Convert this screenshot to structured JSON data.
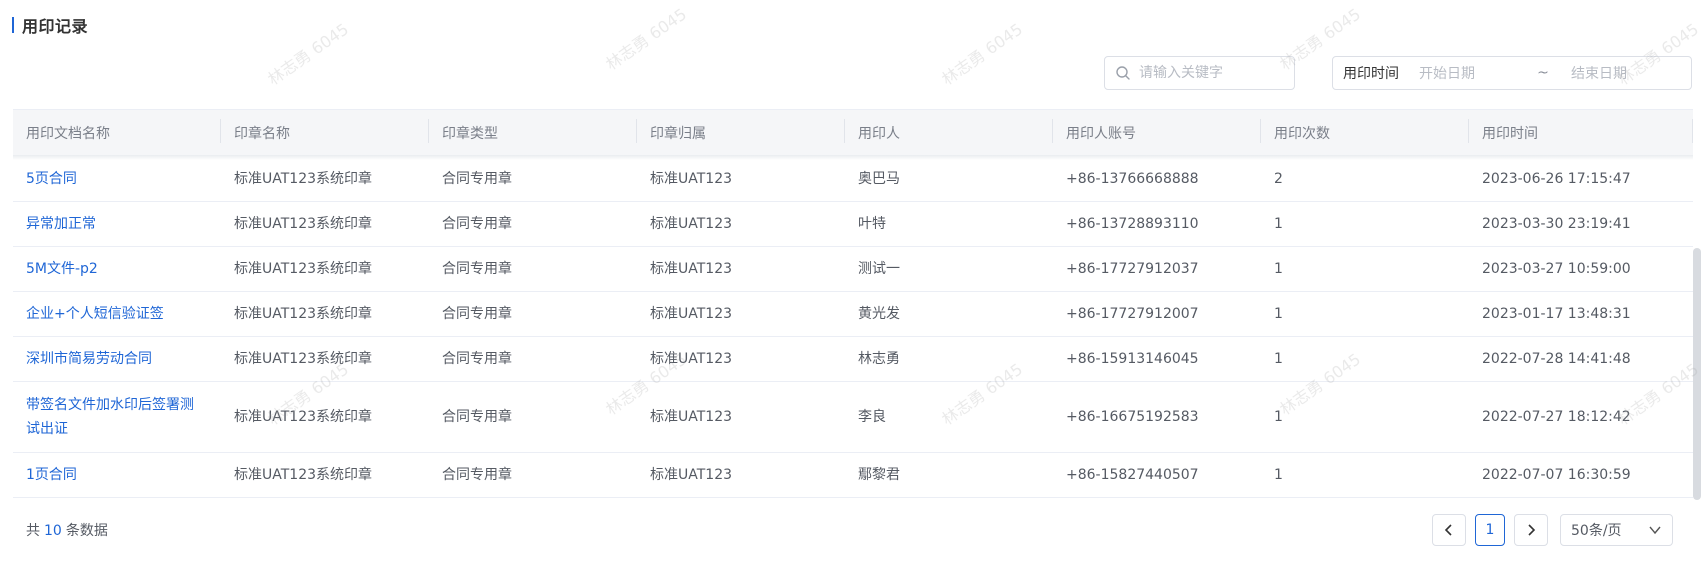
{
  "page": {
    "title": "用印记录"
  },
  "filters": {
    "search_placeholder": "请输入关键字",
    "date_label": "用印时间",
    "date_start_placeholder": "开始日期",
    "date_separator": "~",
    "date_end_placeholder": "结束日期"
  },
  "table": {
    "columns": [
      "用印文档名称",
      "印章名称",
      "印章类型",
      "印章归属",
      "用印人",
      "用印人账号",
      "用印次数",
      "用印时间"
    ],
    "rows": [
      [
        "5页合同",
        "标准UAT123系统印章",
        "合同专用章",
        "标准UAT123",
        "奥巴马",
        "+86-13766668888",
        "2",
        "2023-06-26 17:15:47"
      ],
      [
        "异常加正常",
        "标准UAT123系统印章",
        "合同专用章",
        "标准UAT123",
        "叶特",
        "+86-13728893110",
        "1",
        "2023-03-30 23:19:41"
      ],
      [
        "5M文件-p2",
        "标准UAT123系统印章",
        "合同专用章",
        "标准UAT123",
        "测试一",
        "+86-17727912037",
        "1",
        "2023-03-27 10:59:00"
      ],
      [
        "企业+个人短信验证签",
        "标准UAT123系统印章",
        "合同专用章",
        "标准UAT123",
        "黄光发",
        "+86-17727912007",
        "1",
        "2023-01-17 13:48:31"
      ],
      [
        "深圳市简易劳动合同",
        "标准UAT123系统印章",
        "合同专用章",
        "标准UAT123",
        "林志勇",
        "+86-15913146045",
        "1",
        "2022-07-28 14:41:48"
      ],
      [
        "带签名文件加水印后签署测试出证",
        "标准UAT123系统印章",
        "合同专用章",
        "标准UAT123",
        "李良",
        "+86-16675192583",
        "1",
        "2022-07-27 18:12:42"
      ],
      [
        "1页合同",
        "标准UAT123系统印章",
        "合同专用章",
        "标准UAT123",
        "鄢黎君",
        "+86-15827440507",
        "1",
        "2022-07-07 16:30:59"
      ]
    ]
  },
  "footer": {
    "total_prefix": "共",
    "total_count": "10",
    "total_suffix": "条数据",
    "current_page": "1",
    "page_size": "50条/页"
  },
  "watermark": {
    "text": "林志勇 6045"
  },
  "colors": {
    "accent": "#1f66d6",
    "header_bg": "#f5f6f8",
    "border": "#ebeef5"
  },
  "icons": {
    "search": "search-icon",
    "prev": "chevron-left-icon",
    "next": "chevron-right-icon",
    "dropdown": "chevron-down-icon"
  }
}
